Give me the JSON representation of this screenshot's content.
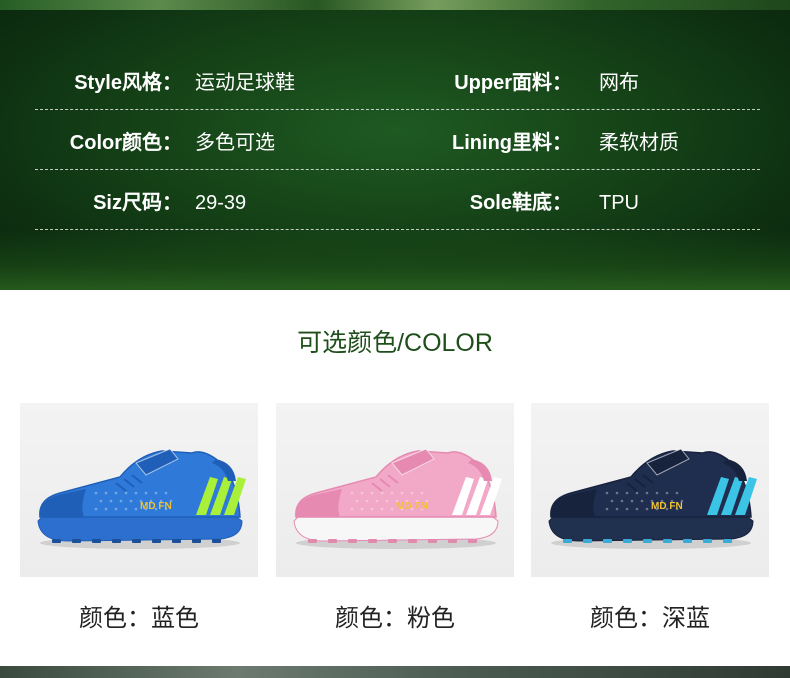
{
  "specs": [
    {
      "left_label": "Style风格：",
      "left_value": "运动足球鞋",
      "right_label": "Upper面料：",
      "right_value": "网布"
    },
    {
      "left_label": "Color颜色：",
      "left_value": "多色可选",
      "right_label": "Lining里料：",
      "right_value": "柔软材质"
    },
    {
      "left_label": "Siz尺码：",
      "left_value": "29-39",
      "right_label": "Sole鞋底：",
      "right_value": "TPU"
    }
  ],
  "color_section_title": "可选颜色/COLOR",
  "products": [
    {
      "caption": "颜色：蓝色",
      "brand": "MD FN",
      "colors": {
        "upper": "#2f7ad9",
        "upper_dark": "#1f5fb8",
        "accent": "#a8f03a",
        "sole": "#2d6fcf",
        "stud": "#1a4f9a"
      }
    },
    {
      "caption": "颜色：粉色",
      "brand": "MD FN",
      "colors": {
        "upper": "#f2a9c8",
        "upper_dark": "#e68ab2",
        "accent": "#ffffff",
        "sole": "#f7f7f7",
        "stud": "#e08aae"
      }
    },
    {
      "caption": "颜色：深蓝",
      "brand": "MD FN",
      "colors": {
        "upper": "#1f2d4f",
        "upper_dark": "#17223d",
        "accent": "#3cc4e6",
        "sole": "#20304f",
        "stud": "#3aa9d6"
      }
    }
  ],
  "theme": {
    "panel_green": "#154217",
    "title_green": "#1e4f1a"
  }
}
